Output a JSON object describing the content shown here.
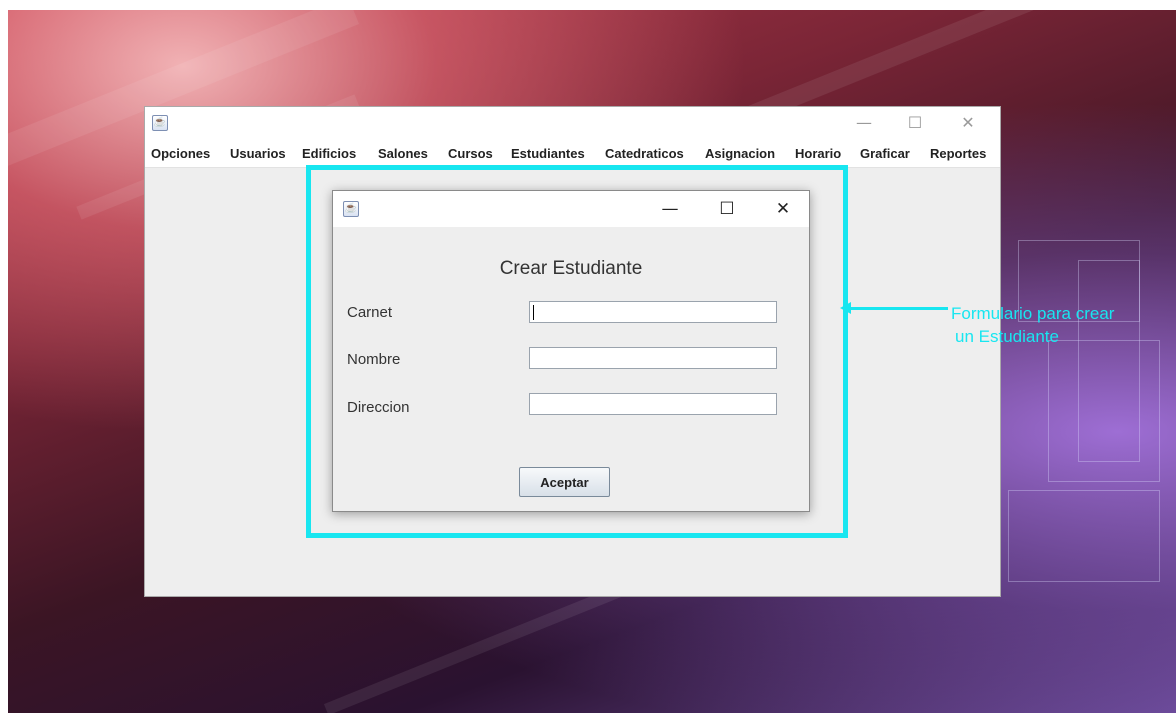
{
  "main_window": {
    "menu": [
      "Opciones",
      "Usuarios",
      "Edificios",
      "Salones",
      "Cursos",
      "Estudiantes",
      "Catedraticos",
      "Asignacion",
      "Horario",
      "Graficar",
      "Reportes"
    ],
    "controls": {
      "minimize": "—",
      "maximize": "☐",
      "close": "✕"
    }
  },
  "dialog": {
    "controls": {
      "minimize": "—",
      "maximize": "☐",
      "close": "✕"
    },
    "title": "Crear Estudiante",
    "fields": [
      {
        "label": "Carnet",
        "value": ""
      },
      {
        "label": "Nombre",
        "value": ""
      },
      {
        "label": "Direccion",
        "value": ""
      }
    ],
    "accept_label": "Aceptar"
  },
  "annotation": {
    "line1": "Formulario para crear",
    "line2": "un Estudiante",
    "color": "#18e6f0"
  }
}
